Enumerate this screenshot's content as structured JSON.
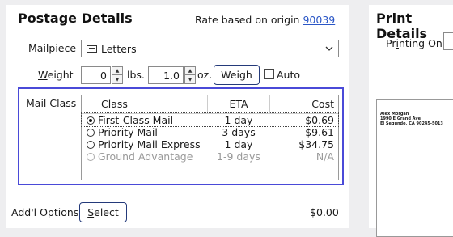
{
  "postage": {
    "title": "Postage Details",
    "rate_prefix": "Rate based on origin",
    "origin_zip": "90039",
    "mailpiece_label": "Mailpiece",
    "mailpiece_value": "Letters",
    "weight_label": "Weight",
    "lbs_value": "0",
    "lbs_unit": "lbs.",
    "oz_value": "1.0",
    "oz_unit": "oz.",
    "weigh_button": "Weigh",
    "auto_label": "Auto",
    "mail_class_label": "Mail Class",
    "columns": {
      "class": "Class",
      "eta": "ETA",
      "cost": "Cost"
    },
    "rows": [
      {
        "class": "First-Class Mail",
        "eta": "1 day",
        "cost": "$0.69",
        "selected": true,
        "enabled": true
      },
      {
        "class": "Priority Mail",
        "eta": "3 days",
        "cost": "$9.61",
        "selected": false,
        "enabled": true
      },
      {
        "class": "Priority Mail Express",
        "eta": "1 day",
        "cost": "$34.75",
        "selected": false,
        "enabled": true
      },
      {
        "class": "Ground Advantage",
        "eta": "1-9 days",
        "cost": "N/A",
        "selected": false,
        "enabled": false
      }
    ],
    "addl_label": "Add'l Options",
    "select_button": "Select",
    "addl_cost": "$0.00"
  },
  "print": {
    "title": "Print Details",
    "printing_on_label": "Printing On",
    "preview_lines": [
      "Alex Morgan",
      "1990 E Grand Ave",
      "El Segundo, CA 90245-5013"
    ]
  },
  "colors": {
    "focus_border": "#4a4ad8",
    "link": "#2a56c6",
    "button_border": "#243a7a"
  }
}
